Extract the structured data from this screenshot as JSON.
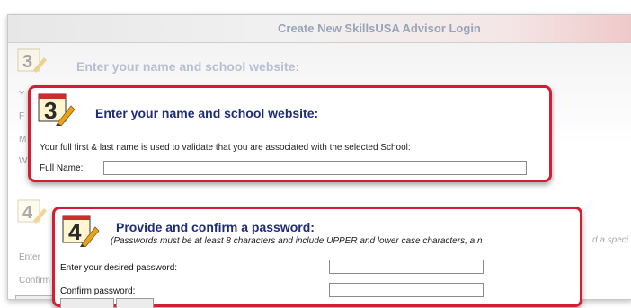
{
  "window": {
    "title": "Create New SkillsUSA Advisor Login"
  },
  "background": {
    "step3_number": "3",
    "step3_heading": "Enter your name and school website:",
    "step4_number": "4",
    "left_fragments": [
      "Y",
      "F",
      "M",
      "W"
    ],
    "enter_fragment": "Enter",
    "confirm_fragment": "Confirm",
    "right_fragment": "d a speci"
  },
  "step3": {
    "number": "3",
    "heading": "Enter your name and school website:",
    "note": "Your full first & last name is used to validate that you are associated with the selected School:",
    "full_name_label": "Full Name:",
    "full_name_value": ""
  },
  "step4": {
    "number": "4",
    "heading": "Provide and confirm a password:",
    "note": "(Passwords must be at least 8 characters and include UPPER and lower case characters, a n",
    "password_label": "Enter your desired password:",
    "password_value": "",
    "confirm_label": "Confirm password:",
    "confirm_value": ""
  },
  "colors": {
    "callout_border": "#d41c32",
    "heading": "#1f2c78",
    "step_icon_number": "#2a2a2a",
    "step_icon_pencil": "#e8a21b"
  },
  "icons": {
    "step_icon": "numbered-pencil-icon"
  }
}
